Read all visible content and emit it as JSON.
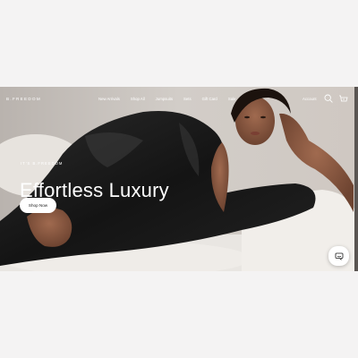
{
  "header": {
    "logo": "B.FREEDOM",
    "nav": [
      "New Arrivals",
      "Shop All",
      "Jumpsuits",
      "Sets",
      "Gift Card",
      "Sale"
    ],
    "account": "Account",
    "cart_count": "0"
  },
  "hero": {
    "kicker": "IT'S B.FREEDOM",
    "headline": "Effortless Luxury",
    "cta": "Shop Now"
  },
  "icons": {
    "search": "search-icon",
    "cart": "cart-icon",
    "chat": "chat-icon"
  },
  "colors": {
    "background": "#f4f3f3",
    "text_on_hero": "#ffffff",
    "button_bg": "#ffffff"
  }
}
